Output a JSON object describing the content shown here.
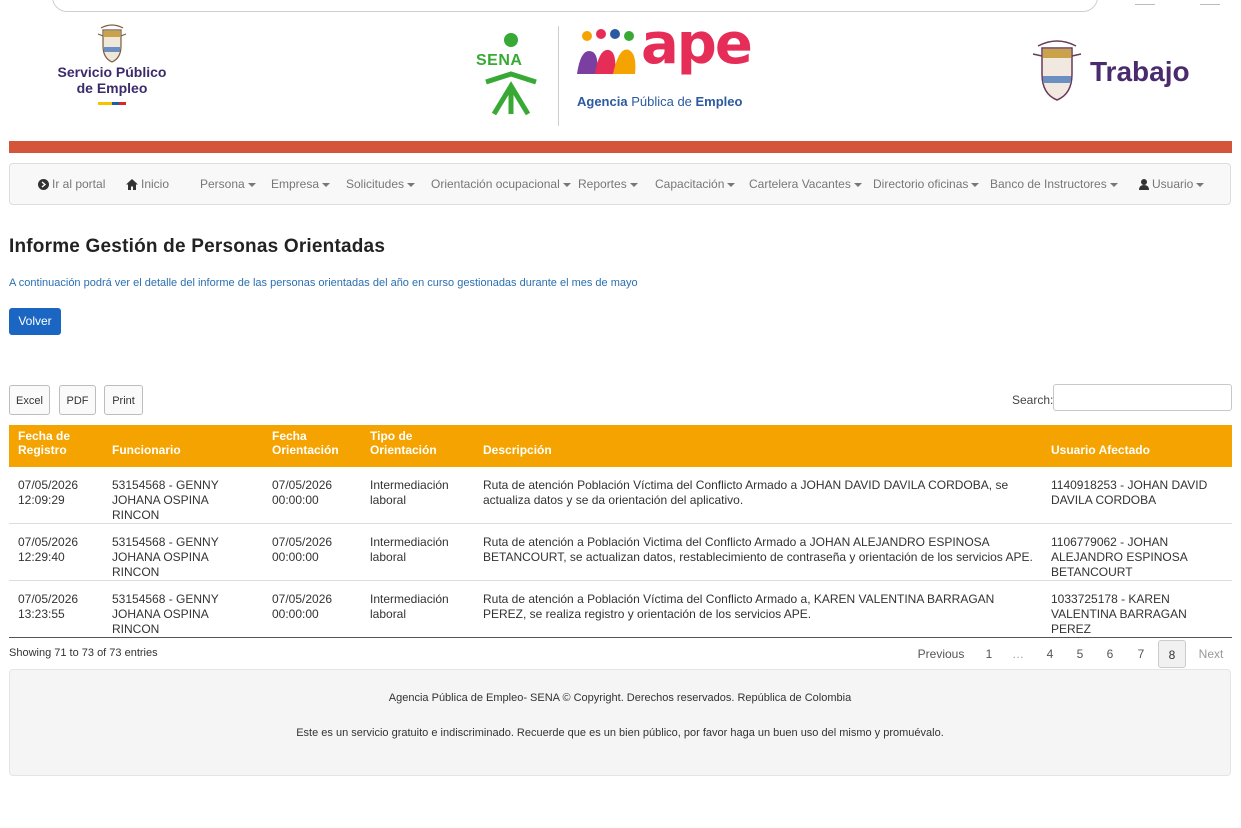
{
  "header": {
    "spe_logo_line1": "Servicio Público",
    "spe_logo_line2": "de Empleo",
    "sena_logo_text": "SENA",
    "ape_logo_word": "ape",
    "ape_logo_sub_bold1": "Agencia",
    "ape_logo_sub_mid": " Pública de ",
    "ape_logo_sub_bold2": "Empleo",
    "trabajo_logo_text": "Trabajo",
    "bar_color": "#d4553a"
  },
  "nav": {
    "portal": "Ir al portal",
    "inicio": "Inicio",
    "persona": "Persona",
    "empresa": "Empresa",
    "solicitudes": "Solicitudes",
    "orientacion": "Orientación ocupacional",
    "reportes": "Reportes",
    "capacitacion": "Capacitación",
    "cartelera": "Cartelera Vacantes",
    "directorio": "Directorio oficinas",
    "banco": "Banco de Instructores",
    "usuario": "Usuario"
  },
  "page": {
    "title": "Informe Gestión de Personas Orientadas",
    "subtitle": "A continuación podrá ver el detalle del informe de las personas orientadas del año en curso gestionadas durante el mes de mayo",
    "back_button": "Volver"
  },
  "toolbar": {
    "excel": "Excel",
    "pdf": "PDF",
    "print": "Print",
    "search_label": "Search:",
    "search_value": ""
  },
  "table": {
    "header_color": "#f5a300",
    "columns": {
      "fecha_registro": "Fecha de Registro",
      "funcionario": "Funcionario",
      "fecha_orientacion": "Fecha Orientación",
      "tipo": "Tipo de Orientación",
      "descripcion": "Descripción",
      "usuario": "Usuario Afectado"
    },
    "rows": [
      {
        "fecha_registro": "07/05/2026 12:09:29",
        "funcionario": "53154568 - GENNY JOHANA OSPINA RINCON",
        "fecha_orientacion": "07/05/2026 00:00:00",
        "tipo": "Intermediación laboral",
        "descripcion": "Ruta de atención Población Víctima del Conflicto Armado a JOHAN DAVID DAVILA CORDOBA, se actualiza datos y se da orientación del aplicativo.",
        "usuario": "1140918253 - JOHAN DAVID DAVILA CORDOBA"
      },
      {
        "fecha_registro": "07/05/2026 12:29:40",
        "funcionario": "53154568 - GENNY JOHANA OSPINA RINCON",
        "fecha_orientacion": "07/05/2026 00:00:00",
        "tipo": "Intermediación laboral",
        "descripcion": "Ruta de atención a Población Victima del Conflicto Armado a JOHAN ALEJANDRO ESPINOSA BETANCOURT, se actualizan datos, restablecimiento de contraseña y orientación de los servicios APE.",
        "usuario": "1106779062 - JOHAN ALEJANDRO ESPINOSA BETANCOURT"
      },
      {
        "fecha_registro": "07/05/2026 13:23:55",
        "funcionario": "53154568 - GENNY JOHANA OSPINA RINCON",
        "fecha_orientacion": "07/05/2026 00:00:00",
        "tipo": "Intermediación laboral",
        "descripcion": "Ruta de atención a Población Víctima del Conflicto Armado a, KAREN VALENTINA BARRAGAN PEREZ, se realiza registro y orientación de los servicios APE.",
        "usuario": "1033725178 - KAREN VALENTINA BARRAGAN PEREZ"
      }
    ]
  },
  "pagination": {
    "showing": "Showing 71 to 73 of 73 entries",
    "previous": "Previous",
    "p1": "1",
    "ellipsis": "…",
    "p4": "4",
    "p5": "5",
    "p6": "6",
    "p7": "7",
    "p8": "8",
    "next": "Next"
  },
  "footer": {
    "line1": "Agencia Pública de Empleo- SENA © Copyright. Derechos reservados. República de Colombia",
    "line2": "Este es un servicio gratuito e indiscriminado. Recuerde que es un bien público, por favor haga un buen uso del mismo y promuévalo."
  }
}
